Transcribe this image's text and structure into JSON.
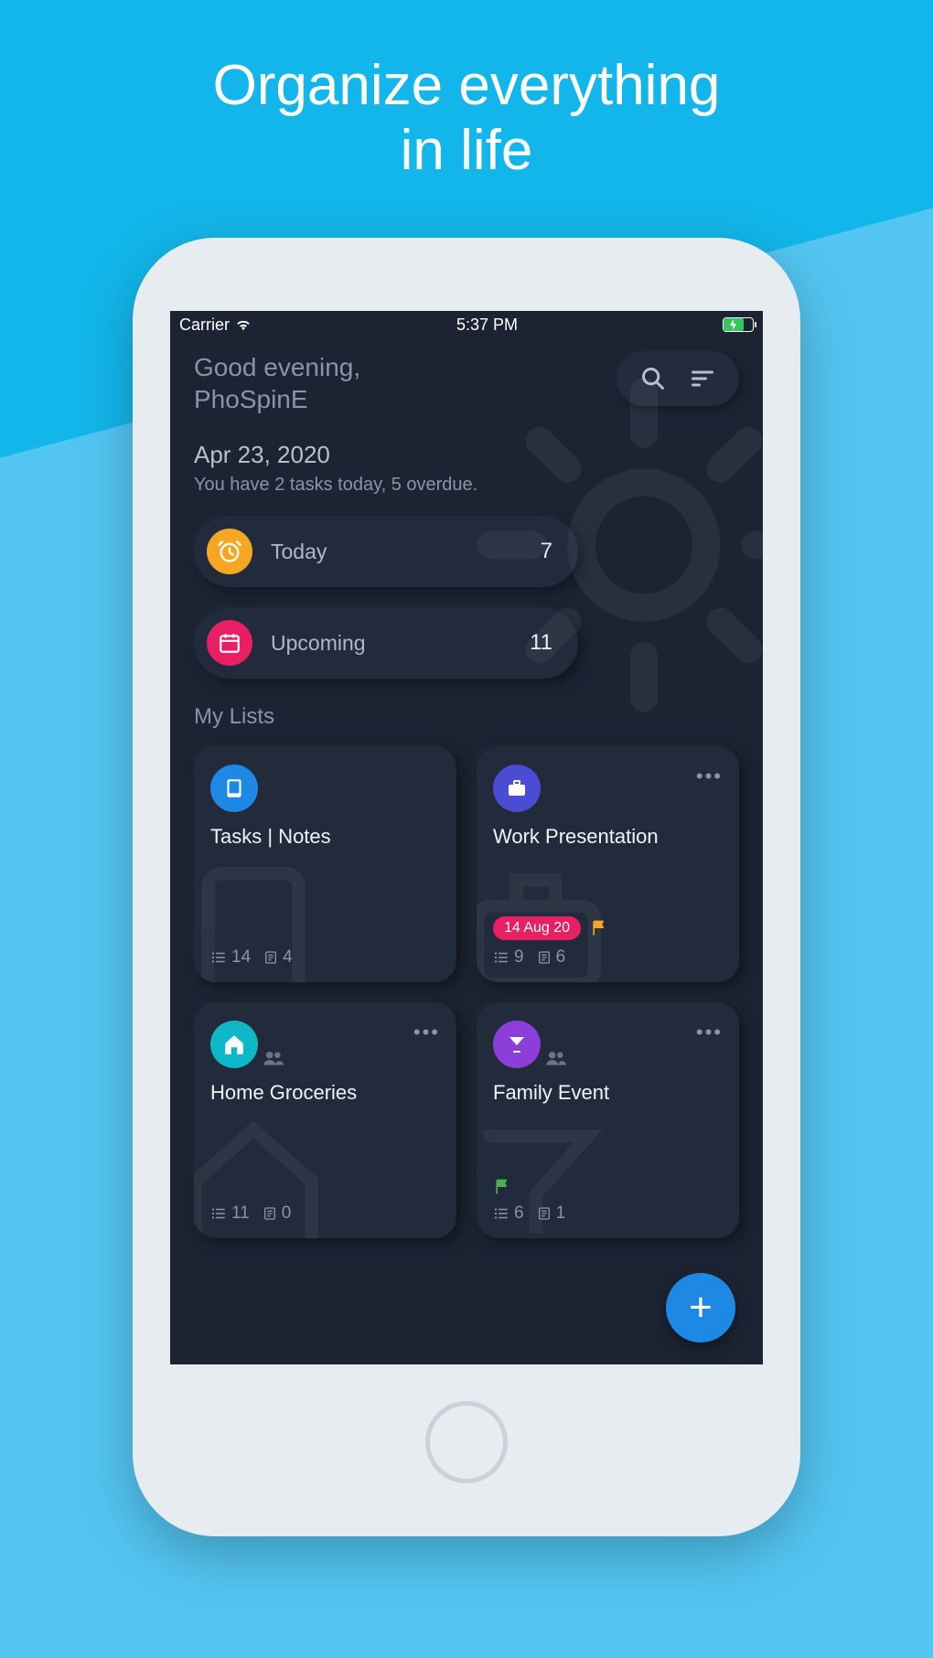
{
  "marketing": {
    "headline_line1": "Organize everything",
    "headline_line2": "in life"
  },
  "status_bar": {
    "carrier": "Carrier",
    "time": "5:37 PM"
  },
  "header": {
    "greeting": "Good evening,",
    "username": "PhoSpinE"
  },
  "summary": {
    "date": "Apr 23, 2020",
    "text": "You have 2 tasks today, 5 overdue."
  },
  "quick": {
    "today": {
      "label": "Today",
      "count": "7",
      "icon": "alarm-icon",
      "color": "#F5A623"
    },
    "upcoming": {
      "label": "Upcoming",
      "count": "11",
      "icon": "calendar-icon",
      "color": "#E81F62"
    }
  },
  "section": {
    "title": "My Lists"
  },
  "cards": [
    {
      "title": "Tasks | Notes",
      "icon": "note-icon",
      "color": "#1E88E5",
      "shared": false,
      "more": false,
      "task_count": "14",
      "note_count": "4",
      "date_badge": null,
      "flag": null
    },
    {
      "title": "Work Presentation",
      "icon": "briefcase-icon",
      "color": "#4A4DD4",
      "shared": false,
      "more": true,
      "task_count": "9",
      "note_count": "6",
      "date_badge": "14 Aug 20",
      "flag": "orange"
    },
    {
      "title": "Home Groceries",
      "icon": "home-icon",
      "color": "#0FB8C9",
      "shared": true,
      "more": true,
      "task_count": "11",
      "note_count": "0",
      "date_badge": null,
      "flag": null
    },
    {
      "title": "Family Event",
      "icon": "cocktail-icon",
      "color": "#8E3ED8",
      "shared": true,
      "more": true,
      "task_count": "6",
      "note_count": "1",
      "date_badge": null,
      "flag": "green"
    }
  ],
  "fab": {
    "label": "+"
  }
}
